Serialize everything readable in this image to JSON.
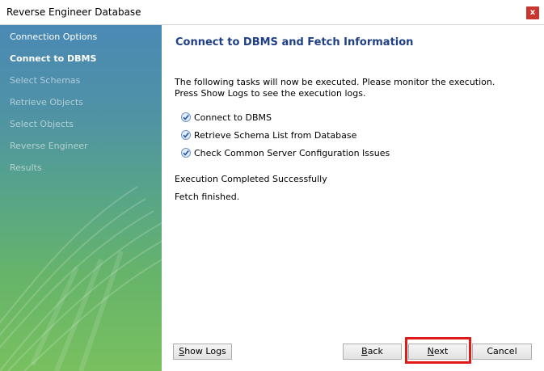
{
  "window": {
    "title": "Reverse Engineer Database",
    "close_label": "x"
  },
  "sidebar": {
    "items": [
      {
        "label": "Connection Options",
        "state": "done"
      },
      {
        "label": "Connect to DBMS",
        "state": "active"
      },
      {
        "label": "Select Schemas",
        "state": "pending"
      },
      {
        "label": "Retrieve Objects",
        "state": "pending"
      },
      {
        "label": "Select Objects",
        "state": "pending"
      },
      {
        "label": "Reverse Engineer",
        "state": "pending"
      },
      {
        "label": "Results",
        "state": "pending"
      }
    ]
  },
  "main": {
    "heading": "Connect to DBMS and Fetch Information",
    "description_line1": "The following tasks will now be executed. Please monitor the execution.",
    "description_line2": "Press Show Logs to see the execution logs.",
    "tasks": [
      {
        "label": "Connect to DBMS",
        "done": true
      },
      {
        "label": "Retrieve Schema List from Database",
        "done": true
      },
      {
        "label": "Check Common Server Configuration Issues",
        "done": true
      }
    ],
    "status_1": "Execution Completed Successfully",
    "status_2": "Fetch finished."
  },
  "buttons": {
    "show_logs": {
      "mnemonic": "S",
      "rest": "how Logs"
    },
    "back": {
      "mnemonic": "B",
      "rest": "ack"
    },
    "next": {
      "mnemonic": "N",
      "rest": "ext"
    },
    "cancel": "Cancel"
  },
  "colors": {
    "heading": "#1f3f86",
    "highlight": "#e01919",
    "check": "#2a5fb0"
  }
}
